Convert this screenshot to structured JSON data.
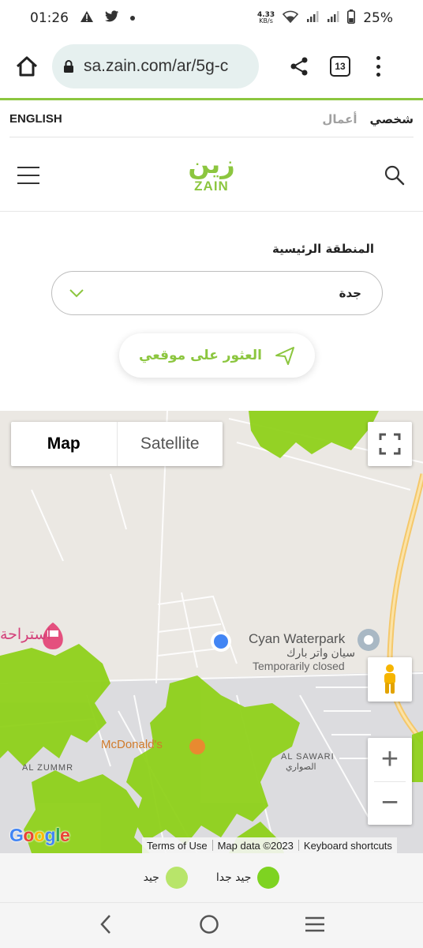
{
  "status_bar": {
    "time": "01:26",
    "net_speed_value": "4.33",
    "net_speed_unit": "KB/s",
    "battery": "25%"
  },
  "browser": {
    "url": "sa.zain.com/ar/5g-c",
    "tab_count": "13"
  },
  "top_links": {
    "language": "ENGLISH",
    "business": "أعمال",
    "personal": "شخصي"
  },
  "header": {
    "logo_ar": "زين",
    "logo_en": "ZAIN"
  },
  "region": {
    "label": "المنطقة الرئيسية",
    "selected": "جدة"
  },
  "locate": {
    "label": "العثور على موقعي"
  },
  "map": {
    "type_map": "Map",
    "type_satellite": "Satellite",
    "labels": {
      "waterpark": "Cyan Waterpark",
      "waterpark_ar": "سيان واتر بارك",
      "waterpark_status": "Temporarily closed",
      "mcdonalds": "McDonald's",
      "alsawari": "AL SAWARI",
      "alsawari_ar": "الصواري",
      "rest": "استراحة",
      "alzummr": "AL ZUMMR"
    },
    "google_logo": "Google",
    "attribution": {
      "terms": "Terms of Use",
      "data": "Map data ©2023",
      "shortcuts": "Keyboard shortcuts"
    },
    "zoom_in": "+",
    "zoom_out": "−"
  },
  "legend": {
    "very_good": "جيد جدا",
    "good": "جيد",
    "very_good_color": "#7ed321",
    "good_color": "#b8e56a"
  }
}
